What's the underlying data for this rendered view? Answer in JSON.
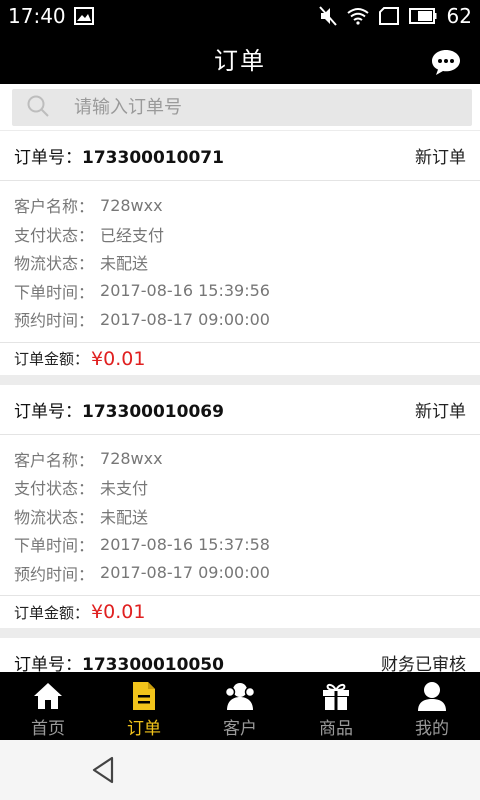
{
  "status_bar": {
    "time": "17:40",
    "battery": "62"
  },
  "header": {
    "title": "订单"
  },
  "search": {
    "placeholder": "请输入订单号",
    "value": ""
  },
  "orders": [
    {
      "no_label": "订单号：",
      "no": "173300010071",
      "status": "新订单",
      "fields": [
        {
          "label": "客户名称：",
          "value": "728wxx"
        },
        {
          "label": "支付状态：",
          "value": "已经支付"
        },
        {
          "label": "物流状态：",
          "value": "未配送"
        },
        {
          "label": "下单时间：",
          "value": "2017-08-16 15:39:56"
        },
        {
          "label": "预约时间：",
          "value": "2017-08-17 09:00:00"
        }
      ],
      "amount_label": "订单金额：",
      "amount": "¥0.01"
    },
    {
      "no_label": "订单号：",
      "no": "173300010069",
      "status": "新订单",
      "fields": [
        {
          "label": "客户名称：",
          "value": "728wxx"
        },
        {
          "label": "支付状态：",
          "value": "未支付"
        },
        {
          "label": "物流状态：",
          "value": "未配送"
        },
        {
          "label": "下单时间：",
          "value": "2017-08-16 15:37:58"
        },
        {
          "label": "预约时间：",
          "value": "2017-08-17 09:00:00"
        }
      ],
      "amount_label": "订单金额：",
      "amount": "¥0.01"
    },
    {
      "no_label": "订单号：",
      "no": "173300010050",
      "status": "财务已审核"
    }
  ],
  "tabs": [
    {
      "label": "首页",
      "icon": "home-icon",
      "active": false
    },
    {
      "label": "订单",
      "icon": "document-icon",
      "active": true
    },
    {
      "label": "客户",
      "icon": "customers-icon",
      "active": false
    },
    {
      "label": "商品",
      "icon": "gift-icon",
      "active": false
    },
    {
      "label": "我的",
      "icon": "user-icon",
      "active": false
    }
  ],
  "colors": {
    "accent": "#f2c41b",
    "price": "#e02020",
    "bar": "#000000"
  }
}
